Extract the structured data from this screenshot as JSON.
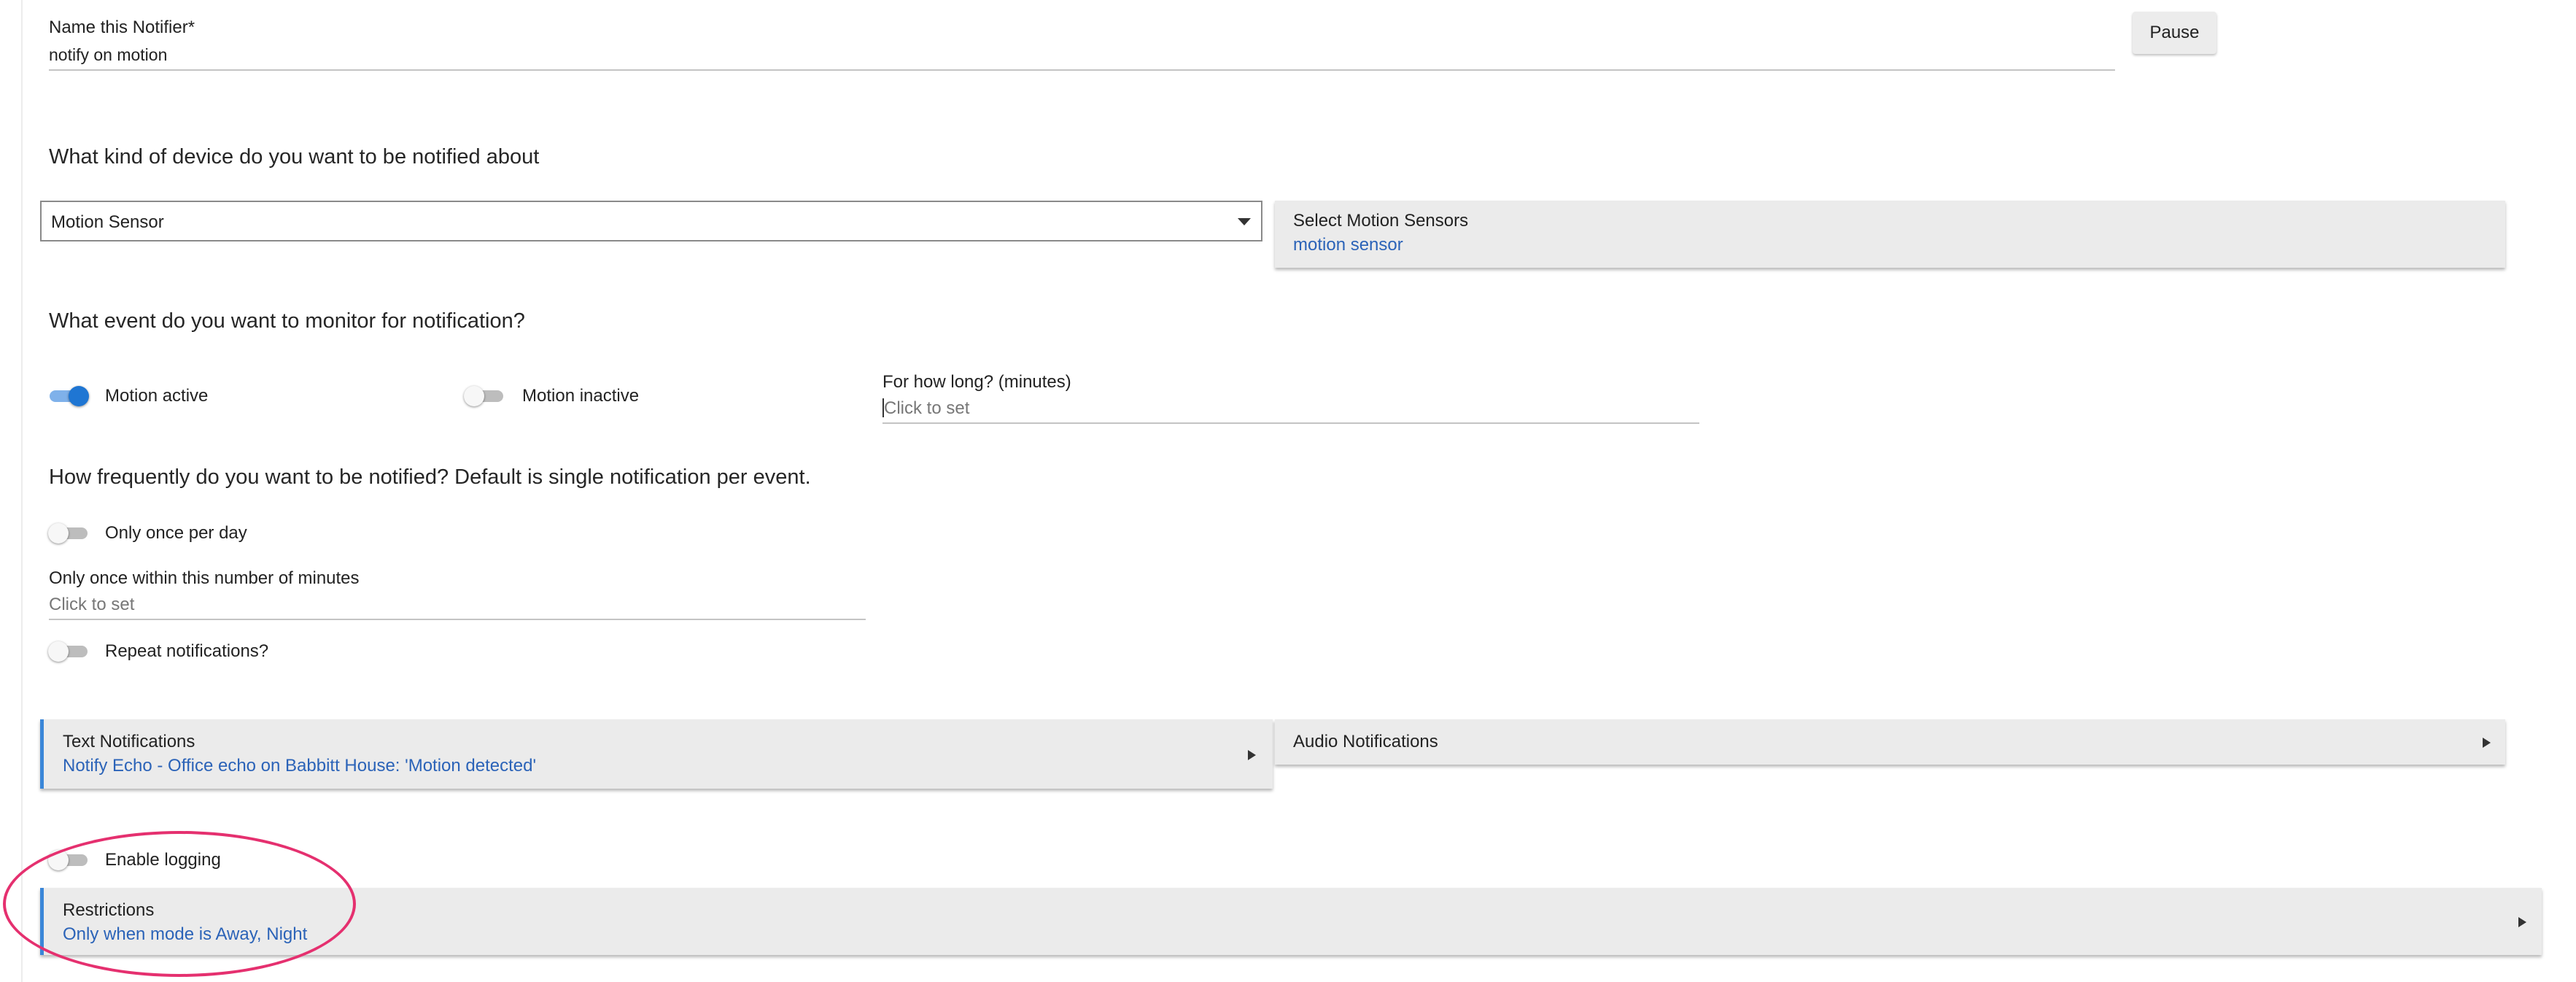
{
  "notifier_name": {
    "label": "Name this Notifier*",
    "value": "notify on motion"
  },
  "pause_button": {
    "label": "Pause"
  },
  "device_question": "What kind of device do you want to be notified about",
  "device_select": {
    "selected": "Motion Sensor"
  },
  "select_sensors": {
    "title": "Select Motion Sensors",
    "value": "motion sensor"
  },
  "event_question": "What event do you want to monitor for notification?",
  "motion_active": {
    "label": "Motion active",
    "on": true
  },
  "motion_inactive": {
    "label": "Motion inactive",
    "on": false
  },
  "duration": {
    "label": "For how long? (minutes)",
    "placeholder": "Click to set"
  },
  "frequency_question": "How frequently do you want to be notified?  Default is single notification per event.",
  "once_per_day": {
    "label": "Only once per day",
    "on": false
  },
  "once_within": {
    "label": "Only once within this number of minutes",
    "placeholder": "Click to set"
  },
  "repeat": {
    "label": "Repeat notifications?",
    "on": false
  },
  "text_notifications": {
    "title": "Text Notifications",
    "value": "Notify Echo - Office echo on Babbitt House: 'Motion detected'"
  },
  "audio_notifications": {
    "title": "Audio Notifications"
  },
  "logging": {
    "label": "Enable logging",
    "on": false
  },
  "restrictions": {
    "title": "Restrictions",
    "value": "Only when mode is Away, Night"
  },
  "colors": {
    "accent_blue": "#3a86d8",
    "link_blue": "#2b63b8",
    "toggle_on": "#1f76d3",
    "highlight": "#e5306f"
  }
}
